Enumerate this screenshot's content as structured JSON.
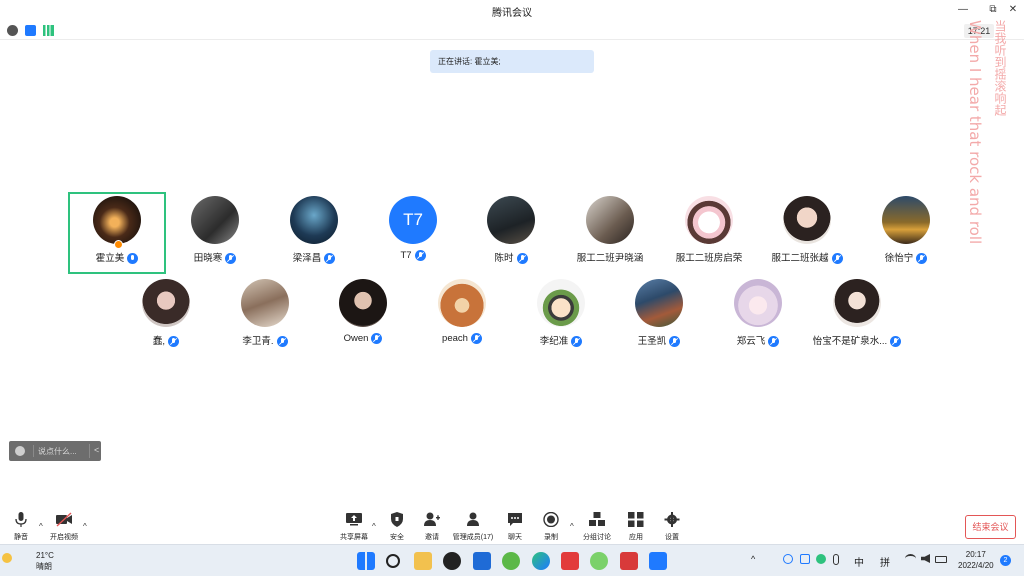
{
  "window": {
    "title": "腾讯会议",
    "minimize": "—",
    "restore": "⧉",
    "close": "✕"
  },
  "infobar": {
    "timer": "17:21"
  },
  "banner": {
    "speaking": "正在讲话: 霍立美;"
  },
  "lyrics": {
    "line1": "当我听到摇滚响起",
    "line2": "When I hear that rock and roll"
  },
  "participants": [
    {
      "name": "霍立美",
      "mic": "active",
      "host": true
    },
    {
      "name": "田晓寒",
      "mic": "muted"
    },
    {
      "name": "梁泽昌",
      "mic": "muted"
    },
    {
      "name": "T7",
      "mic": "muted",
      "initials": "T7"
    },
    {
      "name": "陈时",
      "mic": "muted"
    },
    {
      "name": "服工二班尹晓涵",
      "mic": "none"
    },
    {
      "name": "服工二班房启荣",
      "mic": "none"
    },
    {
      "name": "服工二班张越",
      "mic": "muted"
    },
    {
      "name": "徐怡宁",
      "mic": "muted"
    },
    {
      "name": "蠢,",
      "mic": "muted"
    },
    {
      "name": "李卫青.",
      "mic": "muted"
    },
    {
      "name": "Owen",
      "mic": "muted"
    },
    {
      "name": "peach",
      "mic": "muted"
    },
    {
      "name": "李纪准",
      "mic": "muted"
    },
    {
      "name": "王圣凯",
      "mic": "muted"
    },
    {
      "name": "郑云飞",
      "mic": "muted"
    },
    {
      "name": "怡宝不是矿泉水...",
      "mic": "muted"
    }
  ],
  "chat": {
    "placeholder": "说点什么...",
    "collapse": "<"
  },
  "toolbar": {
    "mute": "静音",
    "video": "开启视频",
    "share": "共享屏幕",
    "security": "安全",
    "invite": "邀请",
    "members": "管理成员(17)",
    "chat": "聊天",
    "record": "录制",
    "breakout": "分组讨论",
    "apps": "应用",
    "settings": "设置",
    "end": "结束会议"
  },
  "taskbar": {
    "temp": "21°C",
    "weather": "晴朗",
    "ime1": "中",
    "ime2": "拼",
    "time": "20:17",
    "date": "2022/4/20",
    "notifications": "2"
  },
  "colors": {
    "accent": "#1f7aff",
    "active_border": "#2ec27e",
    "end": "#e35656",
    "lyric": "#f3a9a9"
  }
}
